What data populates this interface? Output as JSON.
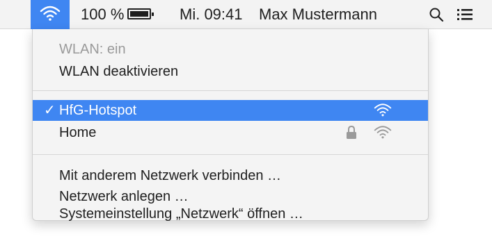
{
  "menubar": {
    "battery_percent": "100 %",
    "battery_level": 1.0,
    "clock": "Mi. 09:41",
    "user": "Max Mustermann",
    "icons": [
      "wifi-icon",
      "battery-icon",
      "spotlight-search-icon",
      "notification-center-icon"
    ]
  },
  "wifi_menu": {
    "status": "WLAN: ein",
    "toggle_label": "WLAN deaktivieren",
    "networks": [
      {
        "name": "HfG-Hotspot",
        "selected": true,
        "locked": false
      },
      {
        "name": "Home",
        "selected": false,
        "locked": true
      }
    ],
    "check_glyph": "✓",
    "actions": [
      "Mit anderem Netzwerk verbinden …",
      "Netzwerk anlegen …",
      "Systemeinstellung „Netzwerk“ öffnen …"
    ]
  },
  "colors": {
    "accent": "#3f86f2",
    "menubar_bg": "#f3f3f3",
    "menu_bg": "#f4f4f4",
    "text": "#1e1e1e",
    "disabled_text": "#9a9a9a"
  }
}
